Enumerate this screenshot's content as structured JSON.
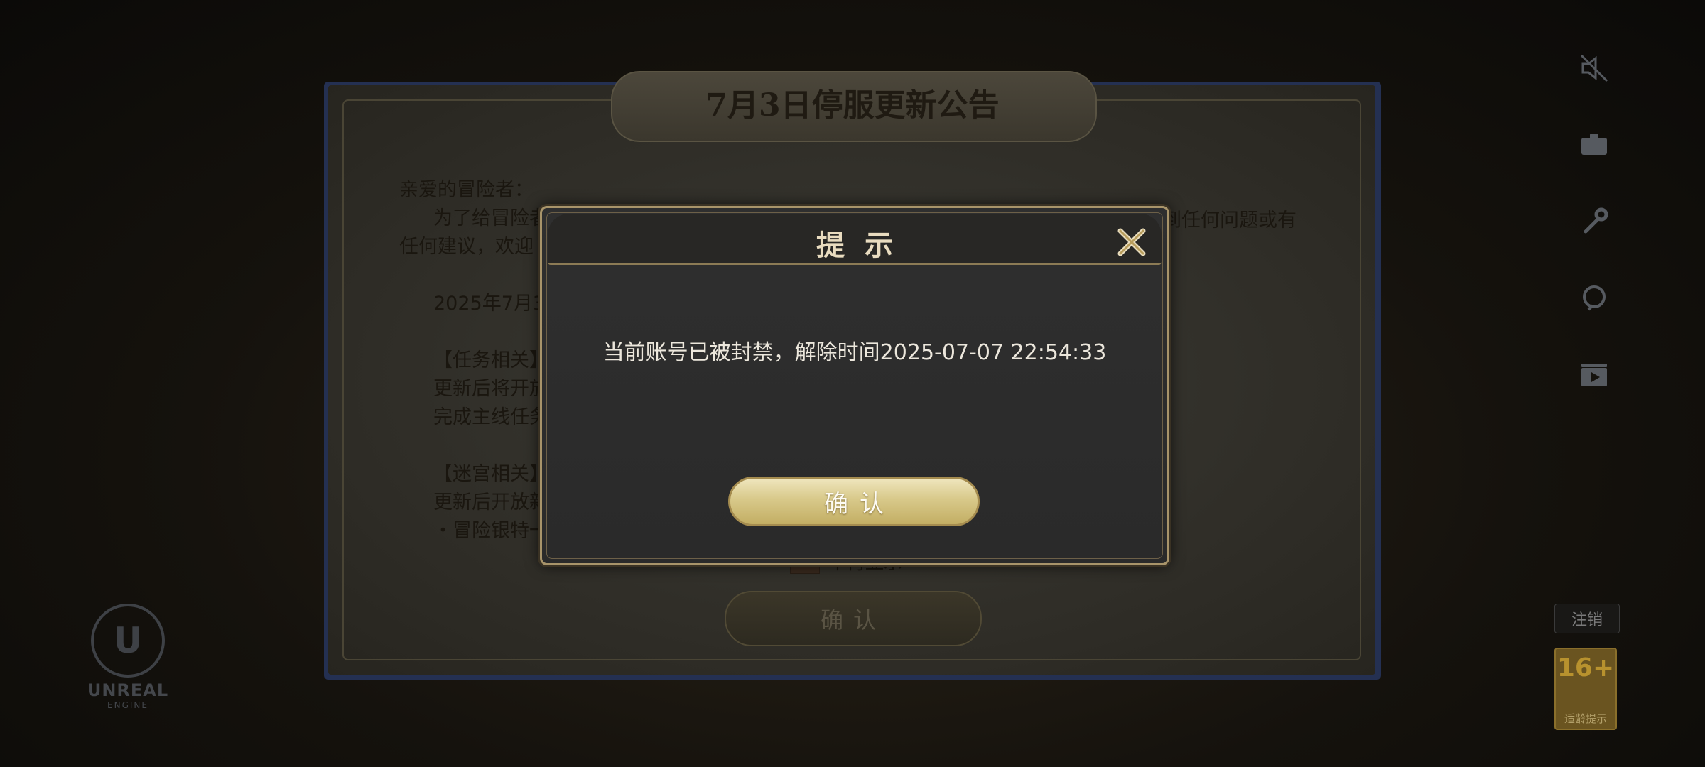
{
  "announcement": {
    "title": "7月3日停服更新公告",
    "greeting": "亲爱的冒险者：",
    "line1": "为了给冒险者",
    "line1_right": "到任何问题或有",
    "line2": "任何建议，欢迎",
    "date_line": "2025年7月3",
    "section_task": "【任务相关】",
    "task_line1": "更新后将开放",
    "task_line2": "完成主线任务",
    "section_maze": "【迷宫相关】",
    "maze_line1": "更新后开放新",
    "maze_line2": "・冒险银特一",
    "dont_show_label": "不再显示",
    "confirm_label": "确认"
  },
  "dialog": {
    "title": "提示",
    "message": "当前账号已被封禁，解除时间2025-07-07 22:54:33",
    "confirm_label": "确认"
  },
  "side": {
    "logout_label": "注销",
    "age_rating": "16+",
    "age_caption": "适龄提示"
  },
  "branding": {
    "engine_word": "UNREAL",
    "engine_sub": "ENGINE"
  },
  "colors": {
    "dialog_border": "#a8946a",
    "confirm_gold": "#d8c98a",
    "notice_frame_blue": "#243052"
  }
}
